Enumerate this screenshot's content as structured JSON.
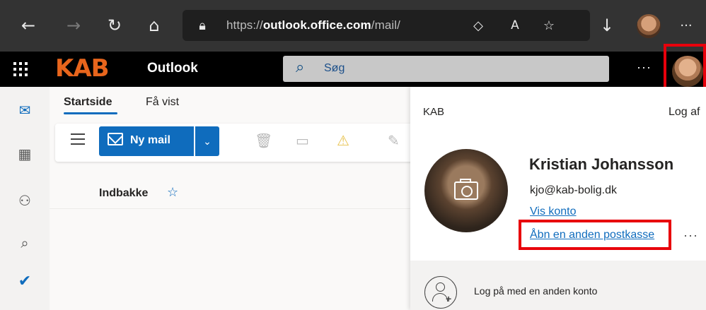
{
  "browser": {
    "url_prefix": "https://",
    "url_domain": "outlook.office.com",
    "url_path": "/mail/",
    "icons": [
      "back-arrow-icon",
      "forward-arrow-icon",
      "refresh-icon",
      "home-icon",
      "lock-icon",
      "reading-view-icon",
      "read-aloud-icon",
      "favorites-icon",
      "download-icon",
      "profile-avatar",
      "more-icon"
    ],
    "more_label": "···"
  },
  "header": {
    "logo_text": "KAB",
    "app_name": "Outlook",
    "search_placeholder": "Søg",
    "more_label": "···",
    "colors": {
      "logo": "#e8651c",
      "background": "#000000"
    }
  },
  "main": {
    "tabs": [
      {
        "label": "Startside",
        "active": true
      },
      {
        "label": "Få vist",
        "active": false
      }
    ],
    "toolbar": {
      "new_mail_label": "Ny mail",
      "split_icon": "chevron-down-icon",
      "icons": [
        "delete-icon",
        "archive-icon",
        "report-icon",
        "sweep-icon"
      ]
    },
    "folder_title": "Indbakke",
    "accent_color": "#0f6cbd"
  },
  "rail": {
    "icons": [
      "mail-icon",
      "calendar-icon",
      "people-icon",
      "attachment-icon",
      "todo-icon"
    ]
  },
  "account_panel": {
    "organization": "KAB",
    "sign_out_label": "Log af",
    "user_name": "Kristian Johansson",
    "email": "kjo@kab-bolig.dk",
    "view_account_label": "Vis konto",
    "open_mailbox_label": "Åbn en anden postkasse",
    "more_label": "···",
    "sign_in_other_label": "Log på med en anden konto"
  },
  "annotations": {
    "highlight_color": "#e8000b"
  }
}
